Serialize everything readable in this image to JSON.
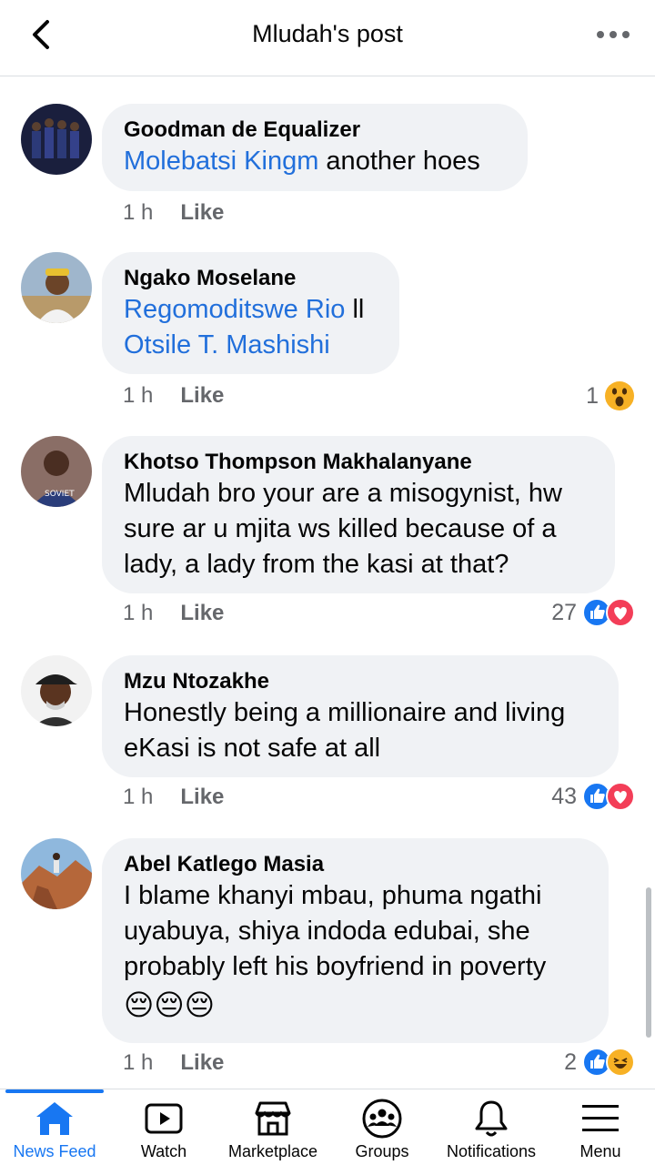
{
  "header": {
    "title": "Mludah's post",
    "back_icon": "chevron-left-icon",
    "more_icon": "more-horizontal-icon"
  },
  "comments": [
    {
      "author": "Goodman de Equalizer",
      "mention": "Molebatsi Kingm",
      "text": " another hoes",
      "time": "1 h",
      "like": "Like"
    },
    {
      "author": "Ngako Moselane",
      "mention": "Regomoditswe Rio",
      "text": " ll",
      "mention2": "Otsile T. Mashishi",
      "time": "1 h",
      "like": "Like",
      "reaction_count": "1",
      "reactions": [
        "wow"
      ]
    },
    {
      "author": "Khotso Thompson Makhalanyane",
      "line1": "Mludah bro your are a misogynist, hw",
      "line2": "sure ar u mjita ws killed because of a",
      "line3": "lady, a lady from the kasi at that?",
      "time": "1 h",
      "like": "Like",
      "reaction_count": "27",
      "reactions": [
        "like",
        "love"
      ]
    },
    {
      "author": "Mzu Ntozakhe",
      "line1": "Honestly being a millionaire and living",
      "line2": "eKasi is not safe at all",
      "time": "1 h",
      "like": "Like",
      "reaction_count": "43",
      "reactions": [
        "like",
        "love"
      ]
    },
    {
      "author": "Abel Katlego Masia",
      "line1": "I blame khanyi mbau, phuma ngathi",
      "line2": "uyabuya, shiya indoda edubai, she",
      "line3": "probably left his boyfriend in poverty",
      "emojis": "😔😔😔",
      "time": "1 h",
      "like": "Like",
      "reaction_count": "2",
      "reactions": [
        "like",
        "haha"
      ]
    }
  ],
  "bottom_nav": [
    {
      "label": "News Feed",
      "icon": "home-icon",
      "active": true
    },
    {
      "label": "Watch",
      "icon": "video-icon"
    },
    {
      "label": "Marketplace",
      "icon": "shop-icon"
    },
    {
      "label": "Groups",
      "icon": "groups-icon"
    },
    {
      "label": "Notifications",
      "icon": "bell-icon"
    },
    {
      "label": "Menu",
      "icon": "menu-icon"
    }
  ],
  "colors": {
    "accent": "#1877f2",
    "mention": "#216fdb",
    "bubble": "#f0f2f5",
    "meta": "#65676b",
    "love": "#f33e58",
    "wow": "#f7b125"
  }
}
